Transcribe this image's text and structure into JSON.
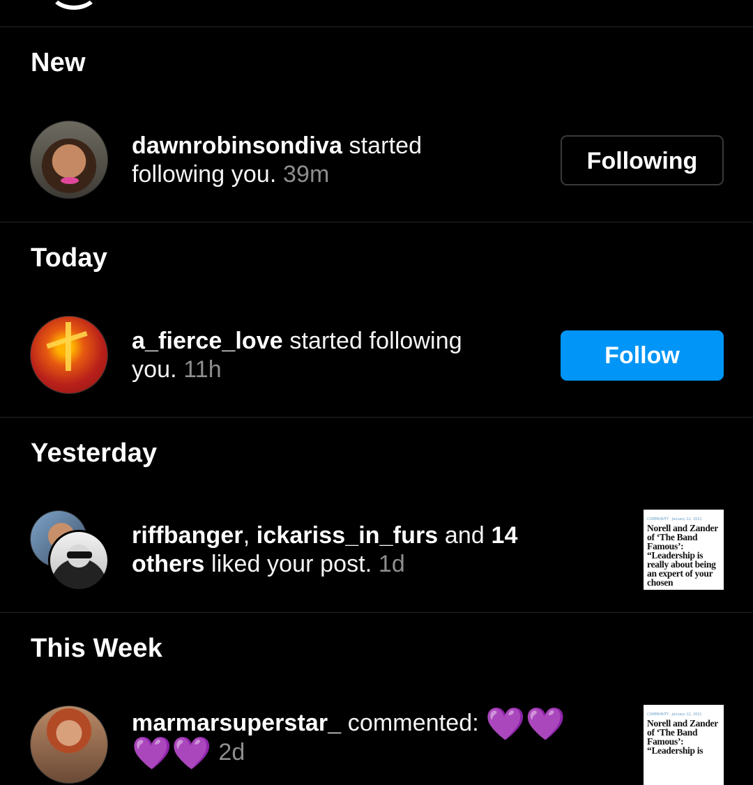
{
  "sections": {
    "new": "New",
    "today": "Today",
    "yesterday": "Yesterday",
    "this_week": "This Week"
  },
  "notifications": [
    {
      "username": "dawnrobinsondiva",
      "text_1": " started",
      "text_2": "following you. ",
      "time": "39m",
      "button_label": "Following"
    },
    {
      "username": "a_fierce_love",
      "text_1": " started following",
      "text_2": "you. ",
      "time": "11h",
      "button_label": "Follow"
    },
    {
      "user_1": "riffbanger",
      "sep": ", ",
      "user_2": "ickariss_in_furs",
      "and": " and ",
      "count": "14",
      "others": "others",
      "action": " liked your post. ",
      "time": "1d",
      "post_meta": "COMMUNITY · January 12, 2021",
      "post_headline": "Norell and Zander of ‘The Band Famous’: “Leadership is really about being an expert of your chosen"
    },
    {
      "username": "marmarsuperstar_",
      "action": " commented: ",
      "hearts": "💜💜",
      "hearts_2": "💜💜",
      "time": "2d",
      "post_meta": "COMMUNITY · January 12, 2021",
      "post_headline": "Norell and Zander of ‘The Band Famous’: “Leadership is"
    }
  ],
  "colors": {
    "background": "#000000",
    "follow_button": "#0095f6",
    "timestamp": "#8e8e8e",
    "heart": "#9d3ff2"
  }
}
